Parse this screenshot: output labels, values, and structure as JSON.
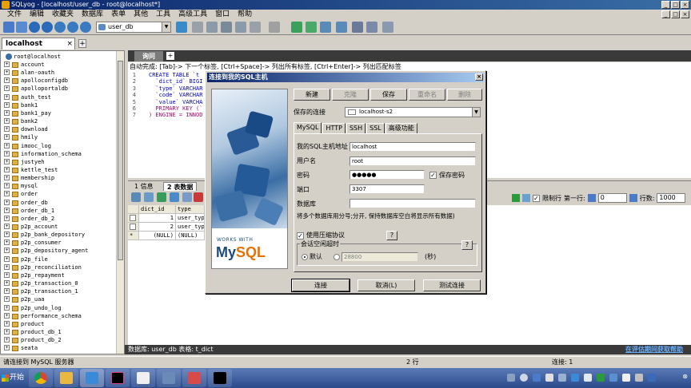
{
  "window": {
    "title": "SQLyog - [localhost/user_db - root@localhost*]",
    "controls": {
      "min": "_",
      "max": "□",
      "close": "×"
    }
  },
  "menu": [
    "文件",
    "编辑",
    "收藏夹",
    "数据库",
    "表单",
    "其他",
    "工具",
    "高级工具",
    "窗口",
    "帮助"
  ],
  "toolbar": {
    "database_select": "user_db"
  },
  "connection_tab": {
    "label": "localhost",
    "close": "×",
    "add": "+"
  },
  "tree": {
    "root": "root@localhost",
    "databases": [
      "account",
      "alan-oauth",
      "apolloconfigdb",
      "apolloportaldb",
      "auth_test",
      "bank1",
      "bank1_pay",
      "bank2",
      "download",
      "hmily",
      "imooc_log",
      "information_schema",
      "justyeh",
      "kettle_test",
      "membership",
      "mysql",
      "order",
      "order_db",
      "order_db_1",
      "order_db_2",
      "p2p_account",
      "p2p_bank_depository",
      "p2p_consumer",
      "p2p_depository_agent",
      "p2p_file",
      "p2p_reconciliation",
      "p2p_repayment",
      "p2p_transaction_0",
      "p2p_transaction_1",
      "p2p_uaa",
      "p2p_undo_log",
      "performance_schema",
      "product",
      "product_db_1",
      "product_db_2",
      "seata"
    ]
  },
  "query_tab": {
    "label": "询问",
    "add": "+"
  },
  "hint_bar": "自动完成: [Tab]-> 下一个标签, [Ctrl+Space]-> 列出所有标签, [Ctrl+Enter]-> 列出匹配标签",
  "editor": {
    "line_numbers": [
      "1",
      "2",
      "3",
      "4",
      "5",
      "6",
      "7"
    ],
    "lines": [
      "CREATE TABLE `t",
      "  `dict_id` BIGI",
      "  `type` VARCHAR",
      "  `code` VARCHAR",
      "  `value` VARCHA",
      "  PRIMARY KEY (`",
      ") ENGINE = INNOD"
    ]
  },
  "results": {
    "tabs": [
      {
        "label": "1 信息"
      },
      {
        "label": "2 表数据"
      }
    ],
    "columns": [
      "dict_id",
      "type"
    ],
    "rows": [
      {
        "marker": "",
        "dict_id": "1",
        "type": "user_typ"
      },
      {
        "marker": "",
        "dict_id": "2",
        "type": "user_typ"
      },
      {
        "marker": "*",
        "dict_id": "(NULL)",
        "type": "(NULL)"
      }
    ],
    "limit_label": "限制行",
    "first_row_label": "第一行:",
    "first_row_value": "0",
    "rows_label": "行数:",
    "rows_value": "1000"
  },
  "db_status": {
    "text": "数据库: user_db  表格: t_dict",
    "help": "在评估期间获取帮助"
  },
  "statusbar": {
    "left": "请连接到 MySQL 服务器",
    "middle": "2 行",
    "right": "连接: 1"
  },
  "taskbar": {
    "start": "开始",
    "clock": "⊗"
  },
  "dialog": {
    "title": "连接到我的SQL主机",
    "close": "×",
    "buttons": {
      "new": "新建",
      "clone": "克隆",
      "save": "保存",
      "rename": "重命名",
      "delete": "删除"
    },
    "saved_label": "保存的连接",
    "saved_value": "localhost-s2",
    "tabs": [
      "MySQL",
      "HTTP",
      "SSH",
      "SSL",
      "高级功能"
    ],
    "fields": {
      "host_label": "我的SQL主机地址",
      "host": "localhost",
      "user_label": "用户名",
      "user": "root",
      "pass_label": "密码",
      "pass": "●●●●●",
      "save_pass": "保存密码",
      "port_label": "端口",
      "port": "3307",
      "db_label": "数据库",
      "db": ""
    },
    "db_hint": "将多个数据库用分号;分开, 保持数据库空白将显示所有数据)",
    "compress": "使用压缩协议",
    "help": "?",
    "timeout_label": "会话空闲超时",
    "timeout_default": "默认",
    "timeout_value": "28800",
    "timeout_unit": "(秒)",
    "connect": "连接",
    "cancel": "取消(L)",
    "test": "测试连接",
    "image_brand_small": "WORKS WITH",
    "image_brand_my": "My",
    "image_brand_sql": "SQL"
  },
  "colors": {
    "accent": "#0a246a",
    "mysql_blue": "#1a4a80",
    "mysql_orange": "#e57200"
  }
}
